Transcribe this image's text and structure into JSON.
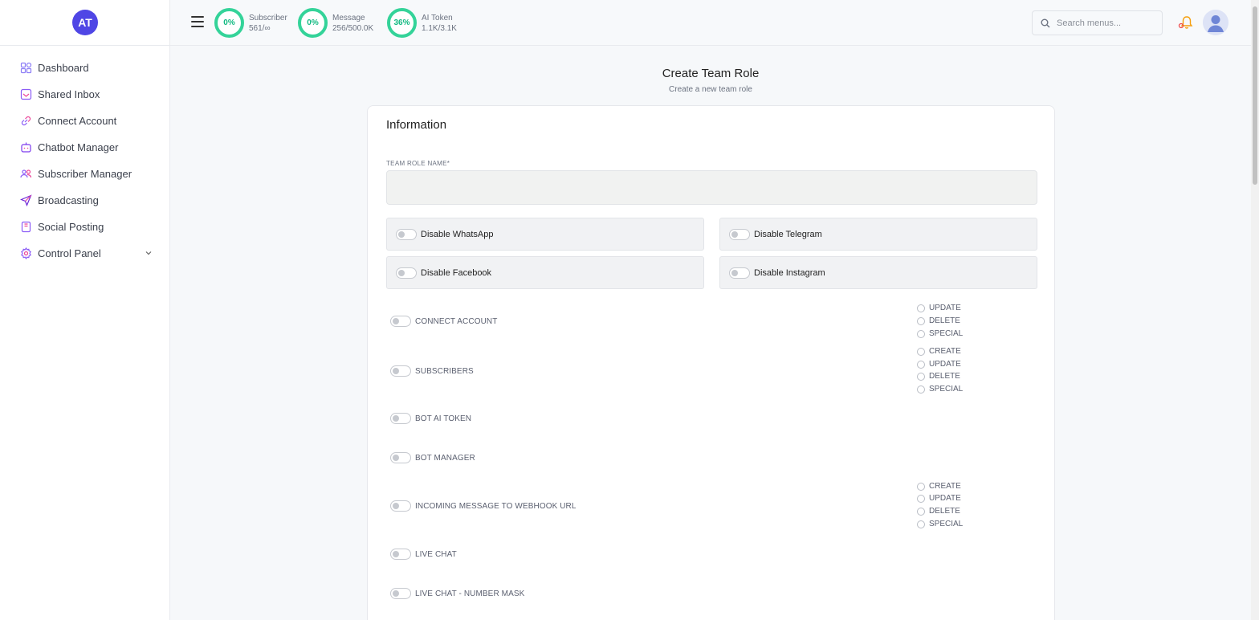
{
  "sidebar": {
    "logo": "AT",
    "items": [
      {
        "label": "Dashboard",
        "icon": "dashboard-icon"
      },
      {
        "label": "Shared Inbox",
        "icon": "inbox-icon"
      },
      {
        "label": "Connect Account",
        "icon": "link-icon"
      },
      {
        "label": "Chatbot Manager",
        "icon": "bot-icon"
      },
      {
        "label": "Subscriber Manager",
        "icon": "users-icon"
      },
      {
        "label": "Broadcasting",
        "icon": "send-icon"
      },
      {
        "label": "Social Posting",
        "icon": "bookmark-icon"
      },
      {
        "label": "Control Panel",
        "icon": "gear-icon"
      }
    ]
  },
  "topbar": {
    "stats": [
      {
        "percent": "0%",
        "label": "Subscriber",
        "value": "561/∞"
      },
      {
        "percent": "0%",
        "label": "Message",
        "value": "256/500.0K"
      },
      {
        "percent": "36%",
        "label": "AI Token",
        "value": "1.1K/3.1K"
      }
    ],
    "search_placeholder": "Search menus...",
    "ring_color": "#34d399"
  },
  "main": {
    "title": "Create Team Role",
    "subtitle": "Create a new team role",
    "card_title": "Information",
    "field_label": "TEAM ROLE NAME*",
    "field_value": "",
    "channel_toggles": [
      "Disable WhatsApp",
      "Disable Telegram",
      "Disable Facebook",
      "Disable Instagram"
    ],
    "permissions": [
      "CONNECT ACCOUNT",
      "SUBSCRIBERS",
      "BOT AI TOKEN",
      "BOT MANAGER",
      "INCOMING MESSAGE TO WEBHOOK URL",
      "LIVE CHAT",
      "LIVE CHAT - NUMBER MASK"
    ],
    "connect_account_options": [
      "UPDATE",
      "DELETE",
      "SPECIAL"
    ],
    "subscribers_options": [
      "CREATE",
      "UPDATE",
      "DELETE",
      "SPECIAL"
    ],
    "webhook_options": [
      "CREATE",
      "UPDATE",
      "DELETE",
      "SPECIAL"
    ]
  }
}
